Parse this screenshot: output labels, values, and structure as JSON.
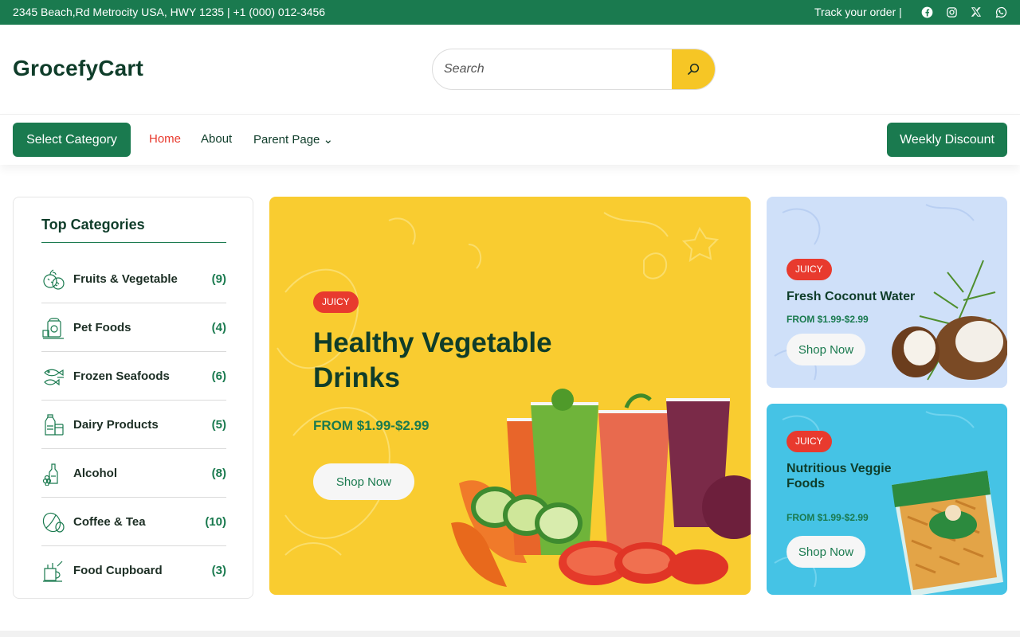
{
  "topbar": {
    "address": "2345 Beach,Rd Metrocity USA, HWY 1235 | +1 (000) 012-3456",
    "track": "Track your order |",
    "social_icons": [
      "facebook-icon",
      "instagram-icon",
      "x-icon",
      "whatsapp-icon"
    ]
  },
  "header": {
    "logo": "GrocefyCart",
    "search_placeholder": "Search"
  },
  "nav": {
    "select_category": "Select Category",
    "links": [
      "Home",
      "About",
      "Parent Page ⌄"
    ],
    "weekly": "Weekly Discount"
  },
  "categories": {
    "title": "Top Categories",
    "items": [
      {
        "name": "Fruits & Vegetable",
        "count": "(9)",
        "icon": "fruits-icon"
      },
      {
        "name": "Pet Foods",
        "count": "(4)",
        "icon": "pet-food-icon"
      },
      {
        "name": "Frozen Seafoods",
        "count": "(6)",
        "icon": "seafood-icon"
      },
      {
        "name": "Dairy Products",
        "count": "(5)",
        "icon": "dairy-icon"
      },
      {
        "name": "Alcohol",
        "count": "(8)",
        "icon": "alcohol-icon"
      },
      {
        "name": "Coffee & Tea",
        "count": "(10)",
        "icon": "coffee-icon"
      },
      {
        "name": "Food Cupboard",
        "count": "(3)",
        "icon": "cupboard-icon"
      }
    ]
  },
  "hero": {
    "badge": "JUICY",
    "title": "Healthy Vegetable Drinks",
    "price": "FROM $1.99-$2.99",
    "button": "Shop Now"
  },
  "cards": [
    {
      "badge": "JUICY",
      "title": "Fresh Coconut Water",
      "price": "FROM $1.99-$2.99",
      "button": "Shop Now"
    },
    {
      "badge": "JUICY",
      "title": "Nutritious Veggie Foods",
      "price": "FROM $1.99-$2.99",
      "button": "Shop Now"
    }
  ],
  "colors": {
    "primary": "#1a7a4f",
    "accent": "#e83a2e",
    "yellow": "#f9cc30",
    "dark": "#0f3d2a"
  }
}
